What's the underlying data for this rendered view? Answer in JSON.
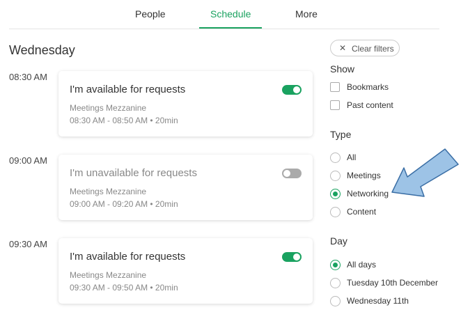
{
  "tabs": [
    {
      "label": "People",
      "active": false
    },
    {
      "label": "Schedule",
      "active": true
    },
    {
      "label": "More",
      "active": false
    }
  ],
  "day_title": "Wednesday",
  "slots": [
    {
      "time": "08:30 AM",
      "title": "I'm available for requests",
      "location": "Meetings Mezzanine",
      "when": "08:30 AM - 08:50 AM • 20min",
      "available": true
    },
    {
      "time": "09:00 AM",
      "title": "I'm unavailable for requests",
      "location": "Meetings Mezzanine",
      "when": "09:00 AM - 09:20 AM • 20min",
      "available": false
    },
    {
      "time": "09:30 AM",
      "title": "I'm available for requests",
      "location": "Meetings Mezzanine",
      "when": "09:30 AM - 09:50 AM • 20min",
      "available": true
    }
  ],
  "filters": {
    "clear_label": "Clear filters",
    "show": {
      "title": "Show",
      "options": [
        {
          "label": "Bookmarks",
          "checked": false
        },
        {
          "label": "Past content",
          "checked": false
        }
      ]
    },
    "type": {
      "title": "Type",
      "options": [
        {
          "label": "All",
          "selected": false
        },
        {
          "label": "Meetings",
          "selected": false
        },
        {
          "label": "Networking",
          "selected": true
        },
        {
          "label": "Content",
          "selected": false
        }
      ]
    },
    "day": {
      "title": "Day",
      "options": [
        {
          "label": "All days",
          "selected": true
        },
        {
          "label": "Tuesday 10th December",
          "selected": false
        },
        {
          "label": "Wednesday 11th",
          "selected": false
        }
      ]
    }
  },
  "colors": {
    "accent": "#1aa260",
    "toggle_off": "#aaaaaa",
    "arrow_fill": "#9dc3e6",
    "arrow_stroke": "#3a6ea5"
  },
  "icons": {
    "clear": "close-icon",
    "annotation": "arrow-annotation"
  }
}
